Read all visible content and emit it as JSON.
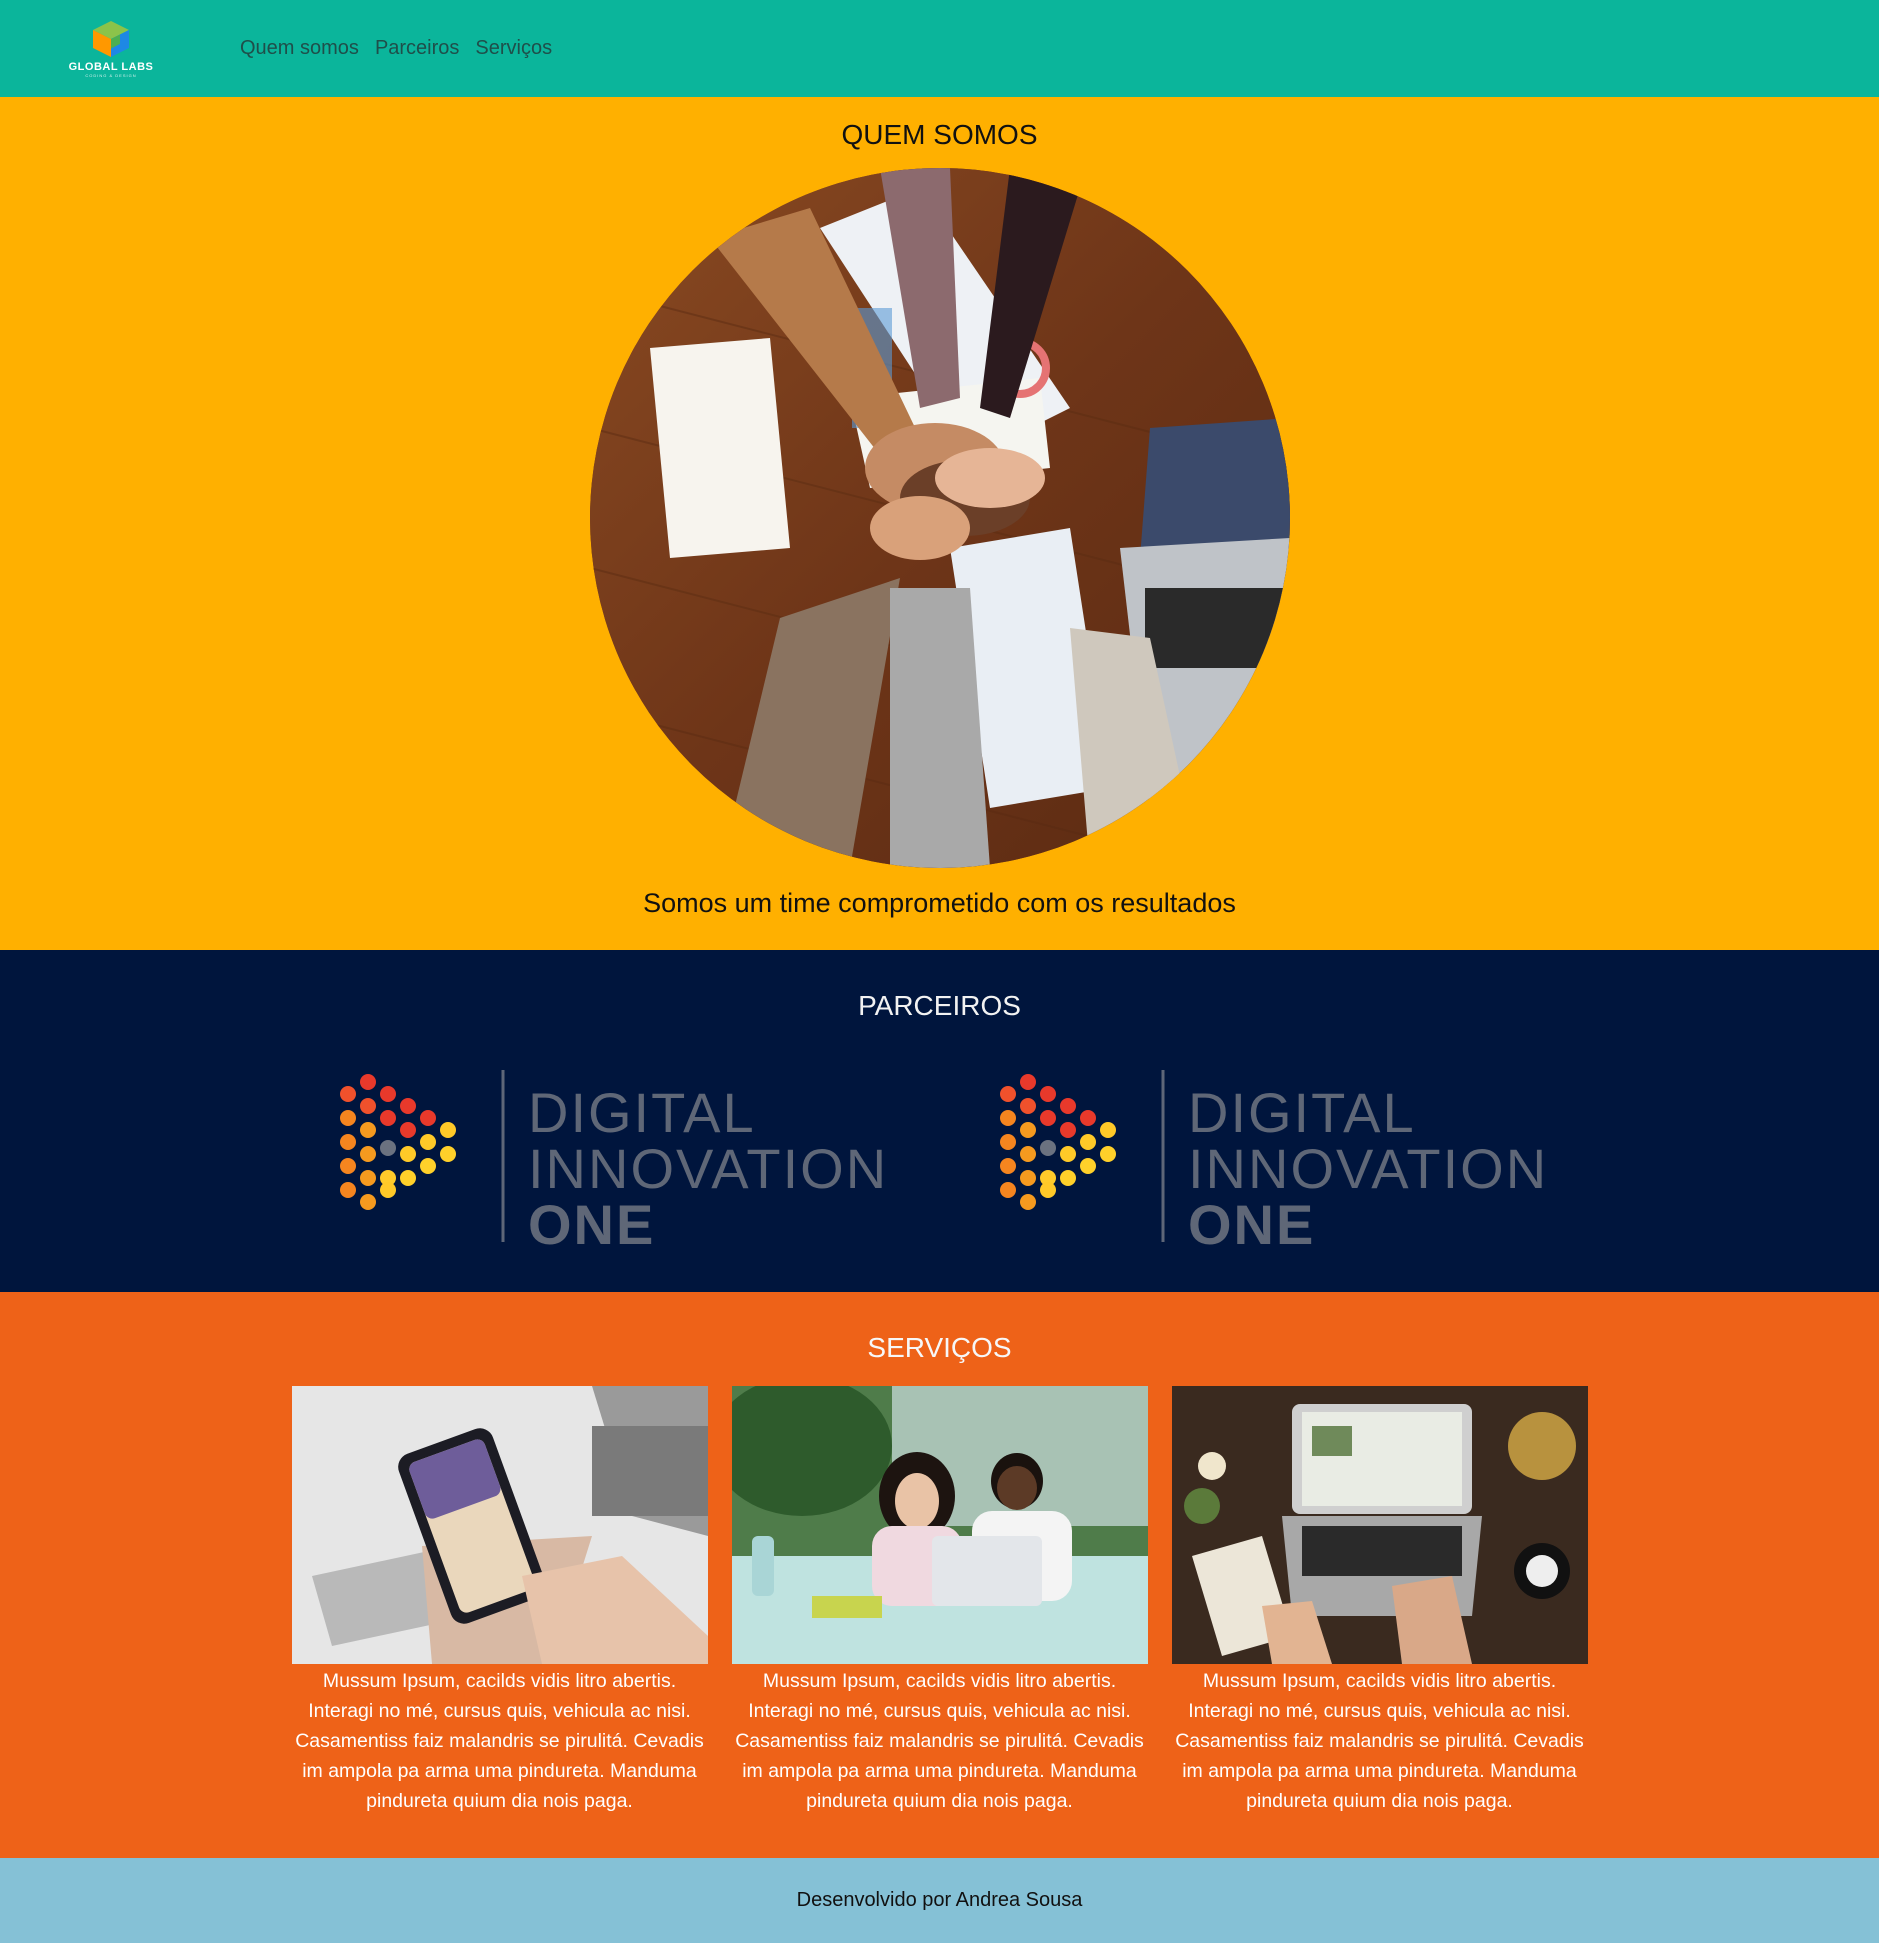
{
  "header": {
    "logo_text": "GLOBAL LABS",
    "logo_subtext": "CODING & DESIGN",
    "nav": [
      "Quem somos",
      "Parceiros",
      "Serviços"
    ]
  },
  "about": {
    "title": "QUEM SOMOS",
    "text": "Somos um time comprometido com os resultados",
    "image": "hands-together-team-photo"
  },
  "partners": {
    "title": "PARCEIROS",
    "logos": [
      {
        "line1": "DIGITAL",
        "line2": "INNOVATION",
        "line3": "ONE"
      },
      {
        "line1": "DIGITAL",
        "line2": "INNOVATION",
        "line3": "ONE"
      }
    ]
  },
  "services": {
    "title": "SERVIÇOS",
    "cards": [
      {
        "image": "phone-in-hands-photo",
        "text": "Mussum Ipsum, cacilds vidis litro abertis. Interagi no mé, cursus quis, vehicula ac nisi. Casamentiss faiz malandris se pirulitá. Cevadis im ampola pa arma uma pindureta. Manduma pindureta quium dia nois paga."
      },
      {
        "image": "students-with-laptop-photo",
        "text": "Mussum Ipsum, cacilds vidis litro abertis. Interagi no mé, cursus quis, vehicula ac nisi. Casamentiss faiz malandris se pirulitá. Cevadis im ampola pa arma uma pindureta. Manduma pindureta quium dia nois paga."
      },
      {
        "image": "laptop-desk-top-view-photo",
        "text": "Mussum Ipsum, cacilds vidis litro abertis. Interagi no mé, cursus quis, vehicula ac nisi. Casamentiss faiz malandris se pirulitá. Cevadis im ampola pa arma uma pindureta. Manduma pindureta quium dia nois paga."
      }
    ]
  },
  "footer": {
    "text": "Desenvolvido por Andrea Sousa"
  },
  "colors": {
    "header": "#0bb59b",
    "about": "#ffb000",
    "partners": "#00153d",
    "services": "#ee6218",
    "footer": "#85c1d6"
  }
}
